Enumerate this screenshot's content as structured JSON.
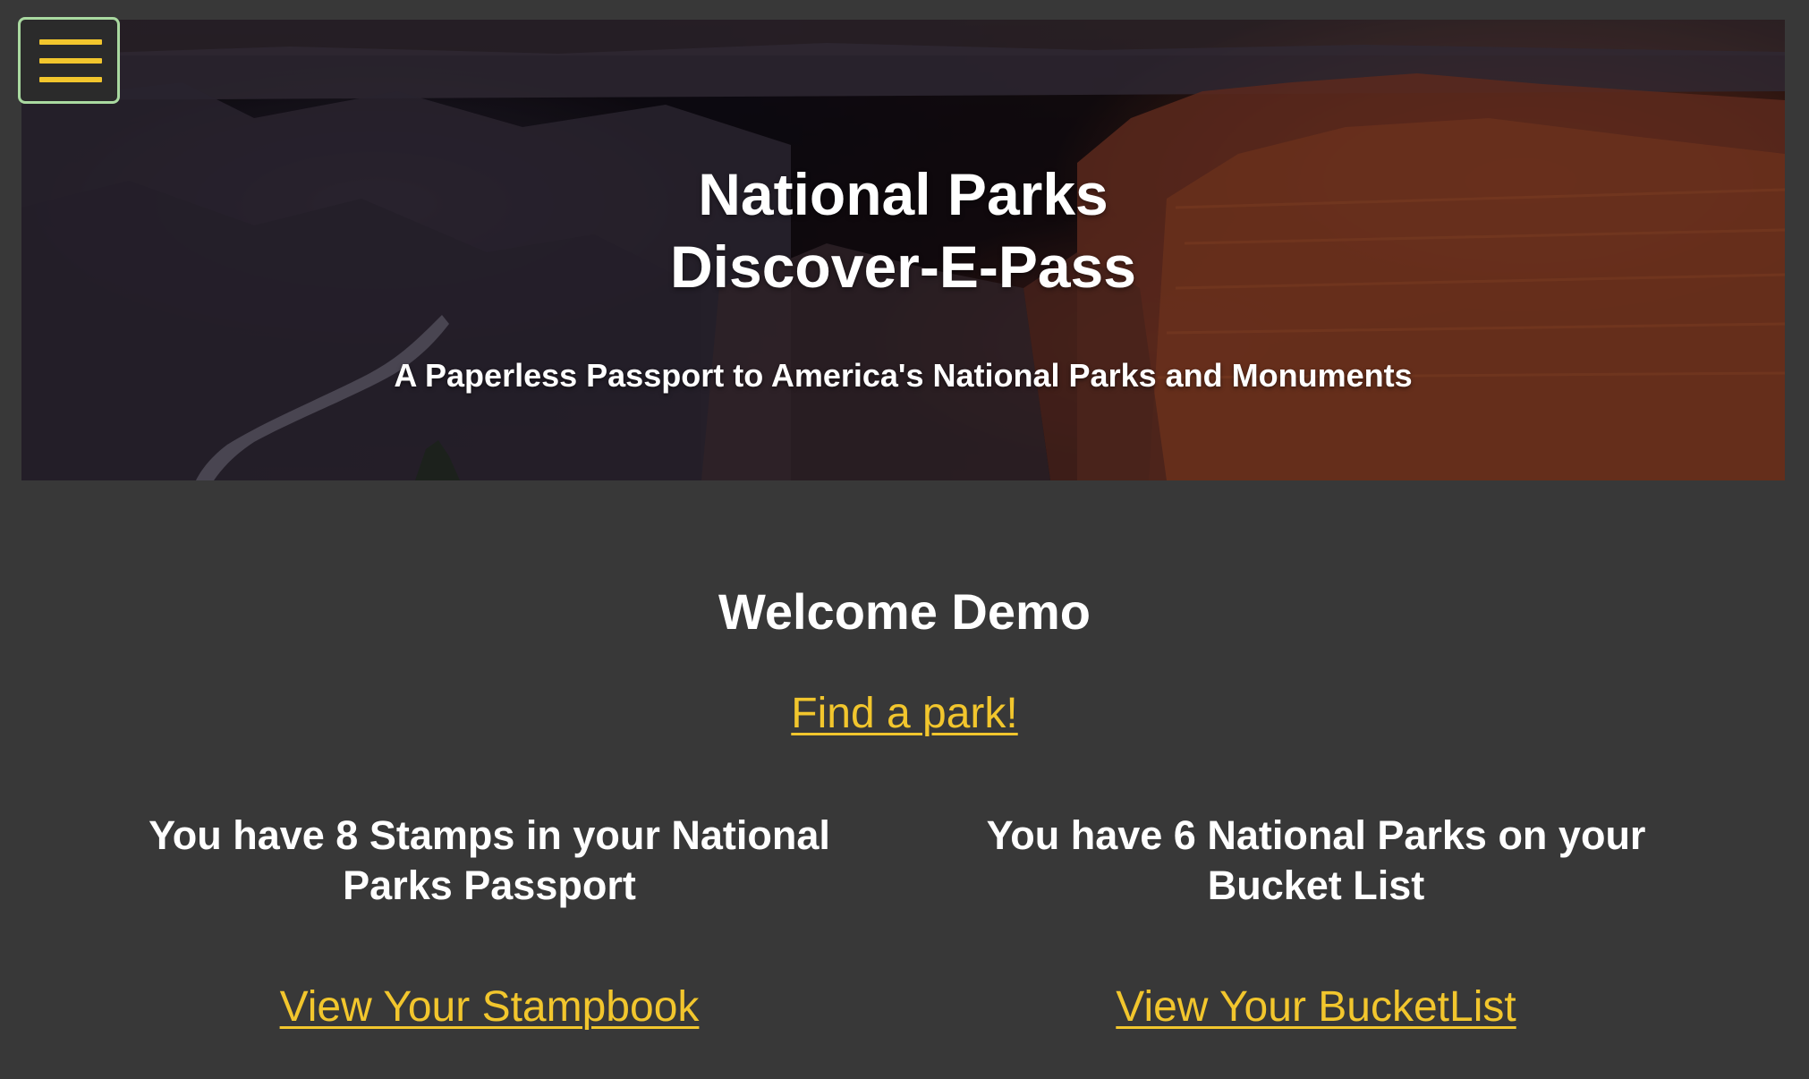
{
  "menu": {
    "icon": "hamburger-menu-icon"
  },
  "hero": {
    "title_line1": "National Parks",
    "title_line2": "Discover-E-Pass",
    "subtitle": "A Paperless Passport to America's National Parks and Monuments"
  },
  "main": {
    "welcome": "Welcome Demo",
    "find_park_link": "Find a park!",
    "stamps": {
      "heading": "You have 8 Stamps in your National Parks Passport",
      "link": "View Your Stampbook"
    },
    "bucketlist": {
      "heading": "You have 6 National Parks on your Bucket List",
      "link": "View Your BucketList"
    }
  },
  "colors": {
    "background": "#383838",
    "accent_link": "#f2c62d",
    "menu_border": "#a9d9a0",
    "text": "#ffffff"
  }
}
